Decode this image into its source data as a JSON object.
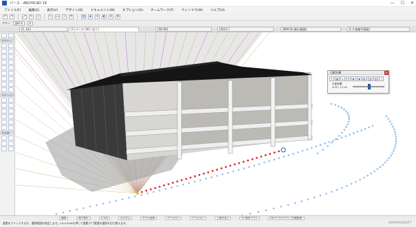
{
  "window": {
    "title": "パース - ARCHICAD 19",
    "controls": [
      "—",
      "☐",
      "✕"
    ]
  },
  "menu": [
    "ファイル(F)",
    "編集(E)",
    "表示(V)",
    "デザイン(D)",
    "ドキュメント(M)",
    "オプション(O)",
    "チームワーク(T)",
    "ウィンドウ(W)",
    "ヘルプ(H)"
  ],
  "infobox": {
    "label": "ボタン",
    "field1": "gen ▾",
    "field2": "▾"
  },
  "tabs": [
    "[1. GL]",
    "[1] パース [3D / 全て]",
    "[3D-96]",
    "[4012.]",
    "[BIM 6k 施行/図面]",
    "[1.3 各階平面図]"
  ],
  "toolbox": {
    "sections": [
      "デザイン",
      "ドキュメント",
      "その他"
    ]
  },
  "sun_palette": {
    "title": "日影計算",
    "date_label": "日影時間",
    "time": "4:05 | 17:45",
    "slider_fraction": 0.52
  },
  "status_fields": [
    "通常",
    "原寸表示",
    "1:100",
    "カスタム",
    "モデル全体",
    "デフォルト",
    "デフォルト",
    "上書きなし",
    "01 既存プラン",
    "OSパースペクティブ(調整済)"
  ],
  "hint": "要素をクリックするか、選択範囲を指定します。Ctrl+Shiftを押して要素/サブ要素の選択を切り替えます。",
  "brand": "GRAPHISOFT",
  "colors": {
    "sun_rays": "#c8b07a",
    "shadow_line": "#dd2a2a",
    "dotted_path": "#8fc0ea",
    "accent": "#1d5aa6"
  }
}
